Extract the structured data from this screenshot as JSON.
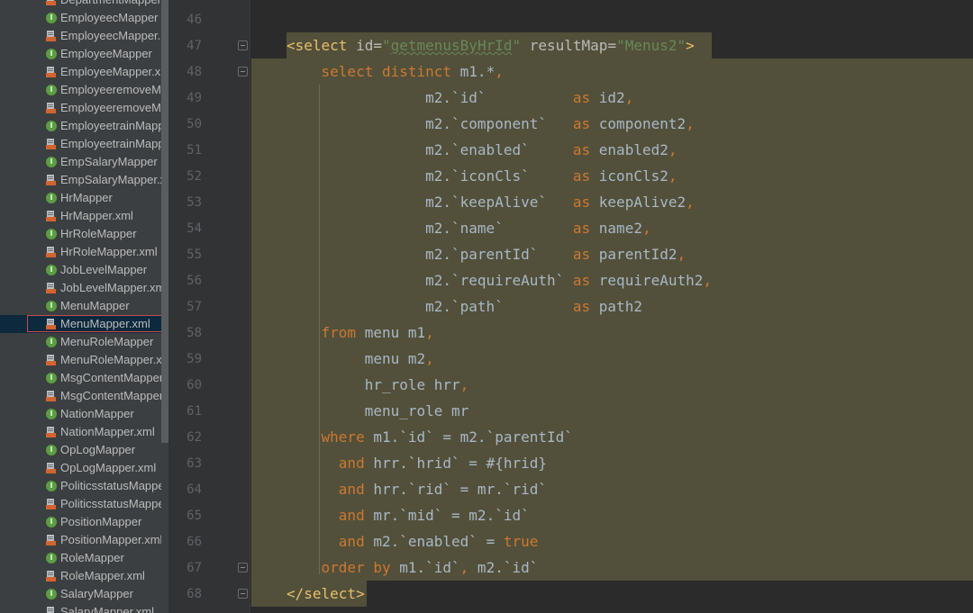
{
  "project_tree": {
    "items": [
      {
        "label": "DepartmentMapper.",
        "type": "xml"
      },
      {
        "label": "EmployeecMapper",
        "type": "class"
      },
      {
        "label": "EmployeecMapper.",
        "type": "xml"
      },
      {
        "label": "EmployeeMapper",
        "type": "class"
      },
      {
        "label": "EmployeeMapper.xm",
        "type": "xml"
      },
      {
        "label": "EmployeeremoveMa",
        "type": "class"
      },
      {
        "label": "EmployeeremoveMa",
        "type": "xml"
      },
      {
        "label": "EmployeetrainMappe",
        "type": "class"
      },
      {
        "label": "EmployeetrainMappe",
        "type": "xml"
      },
      {
        "label": "EmpSalaryMapper",
        "type": "class"
      },
      {
        "label": "EmpSalaryMapper.xn",
        "type": "xml"
      },
      {
        "label": "HrMapper",
        "type": "class"
      },
      {
        "label": "HrMapper.xml",
        "type": "xml"
      },
      {
        "label": "HrRoleMapper",
        "type": "class"
      },
      {
        "label": "HrRoleMapper.xml",
        "type": "xml"
      },
      {
        "label": "JobLevelMapper",
        "type": "class"
      },
      {
        "label": "JobLevelMapper.xml",
        "type": "xml"
      },
      {
        "label": "MenuMapper",
        "type": "class"
      },
      {
        "label": "MenuMapper.xml",
        "type": "xml",
        "selected": true
      },
      {
        "label": "MenuRoleMapper",
        "type": "class"
      },
      {
        "label": "MenuRoleMapper.xn",
        "type": "xml"
      },
      {
        "label": "MsgContentMapper",
        "type": "class"
      },
      {
        "label": "MsgContentMapper.",
        "type": "xml"
      },
      {
        "label": "NationMapper",
        "type": "class"
      },
      {
        "label": "NationMapper.xml",
        "type": "xml"
      },
      {
        "label": "OpLogMapper",
        "type": "class"
      },
      {
        "label": "OpLogMapper.xml",
        "type": "xml"
      },
      {
        "label": "PoliticsstatusMapper",
        "type": "class"
      },
      {
        "label": "PoliticsstatusMapper",
        "type": "xml"
      },
      {
        "label": "PositionMapper",
        "type": "class"
      },
      {
        "label": "PositionMapper.xml",
        "type": "xml"
      },
      {
        "label": "RoleMapper",
        "type": "class"
      },
      {
        "label": "RoleMapper.xml",
        "type": "xml"
      },
      {
        "label": "SalaryMapper",
        "type": "class"
      },
      {
        "label": "SalaryMapper.xml",
        "type": "xml"
      }
    ]
  },
  "colors": {
    "keyword": "#cc7832",
    "tag": "#e8bf6a",
    "string": "#6a8759",
    "plain": "#a9b7c6",
    "selection_highlight": "#52503a"
  },
  "editor": {
    "line_numbers": [
      "46",
      "47",
      "48",
      "49",
      "50",
      "51",
      "52",
      "53",
      "54",
      "55",
      "56",
      "57",
      "58",
      "59",
      "60",
      "61",
      "62",
      "63",
      "64",
      "65",
      "66",
      "67",
      "68"
    ],
    "lines": [
      [],
      [
        {
          "t": "<select",
          "c": "tag"
        },
        {
          "t": " id=",
          "c": "attr"
        },
        {
          "t": "\"",
          "c": "str"
        },
        {
          "t": "getmenusByHrId",
          "c": "str sq"
        },
        {
          "t": "\"",
          "c": "str"
        },
        {
          "t": " resultMap=",
          "c": "attr"
        },
        {
          "t": "\"Menus2\"",
          "c": "str"
        },
        {
          "t": ">",
          "c": "tag"
        }
      ],
      [
        {
          "t": "    "
        },
        {
          "t": "select distinct",
          "c": "kw"
        },
        {
          "t": " m1.*"
        },
        {
          "t": ",",
          "c": "kw"
        }
      ],
      [
        {
          "t": "                m2.`id`          "
        },
        {
          "t": "as",
          "c": "kw"
        },
        {
          "t": " id2"
        },
        {
          "t": ",",
          "c": "kw"
        }
      ],
      [
        {
          "t": "                m2.`component`   "
        },
        {
          "t": "as",
          "c": "kw"
        },
        {
          "t": " component2"
        },
        {
          "t": ",",
          "c": "kw"
        }
      ],
      [
        {
          "t": "                m2.`enabled`     "
        },
        {
          "t": "as",
          "c": "kw"
        },
        {
          "t": " enabled2"
        },
        {
          "t": ",",
          "c": "kw"
        }
      ],
      [
        {
          "t": "                m2.`iconCls`     "
        },
        {
          "t": "as",
          "c": "kw"
        },
        {
          "t": " iconCls2"
        },
        {
          "t": ",",
          "c": "kw"
        }
      ],
      [
        {
          "t": "                m2.`keepAlive`   "
        },
        {
          "t": "as",
          "c": "kw"
        },
        {
          "t": " keepAlive2"
        },
        {
          "t": ",",
          "c": "kw"
        }
      ],
      [
        {
          "t": "                m2.`name`        "
        },
        {
          "t": "as",
          "c": "kw"
        },
        {
          "t": " name2"
        },
        {
          "t": ",",
          "c": "kw"
        }
      ],
      [
        {
          "t": "                m2.`parentId`    "
        },
        {
          "t": "as",
          "c": "kw"
        },
        {
          "t": " parentId2"
        },
        {
          "t": ",",
          "c": "kw"
        }
      ],
      [
        {
          "t": "                m2.`requireAuth` "
        },
        {
          "t": "as",
          "c": "kw"
        },
        {
          "t": " requireAuth2"
        },
        {
          "t": ",",
          "c": "kw"
        }
      ],
      [
        {
          "t": "                m2.`path`        "
        },
        {
          "t": "as",
          "c": "kw"
        },
        {
          "t": " path2"
        }
      ],
      [
        {
          "t": "    "
        },
        {
          "t": "from",
          "c": "kw"
        },
        {
          "t": " menu m1"
        },
        {
          "t": ",",
          "c": "kw"
        }
      ],
      [
        {
          "t": "         menu m2"
        },
        {
          "t": ",",
          "c": "kw"
        }
      ],
      [
        {
          "t": "         hr_role hrr"
        },
        {
          "t": ",",
          "c": "kw"
        }
      ],
      [
        {
          "t": "         menu_role mr"
        }
      ],
      [
        {
          "t": "    "
        },
        {
          "t": "where",
          "c": "kw"
        },
        {
          "t": " m1.`id` = m2.`parentId`"
        }
      ],
      [
        {
          "t": "      "
        },
        {
          "t": "and",
          "c": "kw"
        },
        {
          "t": " hrr.`hrid` = #{hrid}"
        }
      ],
      [
        {
          "t": "      "
        },
        {
          "t": "and",
          "c": "kw"
        },
        {
          "t": " hrr.`rid` = mr.`rid`"
        }
      ],
      [
        {
          "t": "      "
        },
        {
          "t": "and",
          "c": "kw"
        },
        {
          "t": " mr.`mid` = m2.`id`"
        }
      ],
      [
        {
          "t": "      "
        },
        {
          "t": "and",
          "c": "kw"
        },
        {
          "t": " m2.`enabled` = "
        },
        {
          "t": "true",
          "c": "kw"
        }
      ],
      [
        {
          "t": "    "
        },
        {
          "t": "order by",
          "c": "kw"
        },
        {
          "t": " m1.`id`"
        },
        {
          "t": ",",
          "c": "kw"
        },
        {
          "t": " m2.`id`"
        }
      ],
      [
        {
          "t": "</select>",
          "c": "tag"
        }
      ]
    ]
  }
}
